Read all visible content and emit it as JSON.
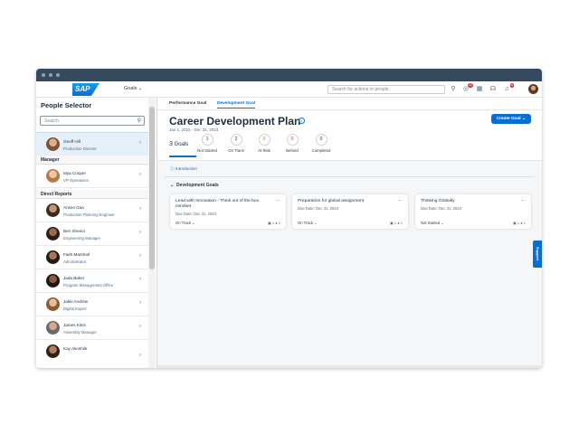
{
  "shell": {
    "logo": "SAP",
    "menu_label": "Goals",
    "search_placeholder": "Search for actions or people",
    "notif_badge_1": "12",
    "notif_badge_2": "6"
  },
  "people_selector": {
    "title": "People Selector",
    "search_placeholder": "Search",
    "selected": {
      "name": "Geoff Hill",
      "role": "Production Director"
    },
    "manager_header": "Manager",
    "manager": {
      "name": "Mya Cooper",
      "role": "VP Operations"
    },
    "direct_reports_header": "Direct Reports",
    "direct_reports": [
      {
        "name": "Anson Gao",
        "role": "Production Planning Engineer"
      },
      {
        "name": "Ben Shenoi",
        "role": "Engineering Manager"
      },
      {
        "name": "Faith Marshall",
        "role": "Administrator"
      },
      {
        "name": "Jada Baker",
        "role": "Program Management Office"
      },
      {
        "name": "Jakki Andrew",
        "role": "Digital Expert"
      },
      {
        "name": "James Klein",
        "role": "Assembly Manager"
      },
      {
        "name": "Kay Akoshile",
        "role": ""
      }
    ]
  },
  "tabs": [
    "Performance Goal",
    "Development Goal"
  ],
  "plan": {
    "title": "Career Development Plan",
    "date_range": "Jan 1, 2022 - Dec 31, 2023",
    "create_button": "Create Goal",
    "goal_count_num": "3",
    "goal_count_label": "Goals",
    "stats": [
      {
        "value": "1",
        "label": "Not Started",
        "color": "#32363a"
      },
      {
        "value": "2",
        "label": "On Track",
        "color": "#32363a"
      },
      {
        "value": "0",
        "label": "At Risk",
        "color": "#e9730c"
      },
      {
        "value": "0",
        "label": "Behind",
        "color": "#d9363e"
      },
      {
        "value": "0",
        "label": "Completed",
        "color": "#32363a"
      }
    ]
  },
  "content": {
    "intro_link": "Introduction",
    "section_title": "Development Goals",
    "cards": [
      {
        "title": "Lead with Innovation - Think out of the box mindset",
        "due": "Due Date: Dec 31, 2023",
        "status": "On Track",
        "attachments": "1",
        "comments": "2"
      },
      {
        "title": "Preparation for global assignment",
        "due": "Due Date: Dec 31, 2023",
        "status": "On Track",
        "attachments": "1",
        "comments": "1"
      },
      {
        "title": "Thinking Globally",
        "due": "Due Date: Dec 31, 2023",
        "status": "Not Started",
        "attachments": "1",
        "comments": "1"
      }
    ]
  },
  "support_label": "Support"
}
